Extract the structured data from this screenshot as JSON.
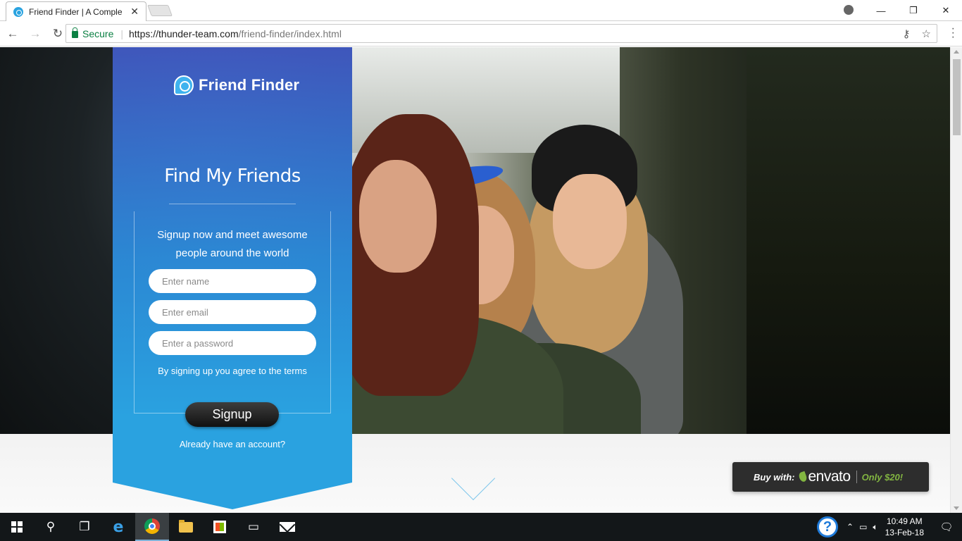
{
  "browser": {
    "tab_title": "Friend Finder | A Comple",
    "tab_close": "✕",
    "secure_label": "Secure",
    "url_host": "https://thunder-team.com",
    "url_path": "/friend-finder/index.html",
    "window_controls": {
      "minimize": "—",
      "maximize": "❐",
      "close": "✕"
    }
  },
  "page": {
    "brand_name": "Friend Finder",
    "title": "Find My Friends",
    "tagline_line1": "Signup now and meet awesome",
    "tagline_line2": "people around the world",
    "name_placeholder": "Enter name",
    "email_placeholder": "Enter email",
    "password_placeholder": "Enter a password",
    "terms_text": "By signing up you agree to the terms",
    "signup_label": "Signup",
    "login_text": "Already have an account?"
  },
  "envato": {
    "buy_with": "Buy with:",
    "brand": "envato",
    "price": "Only $20!"
  },
  "taskbar": {
    "time": "10:49 AM",
    "date": "13-Feb-18"
  },
  "colors": {
    "panel_top": "#425bc8",
    "panel_bottom": "#2aa2e0",
    "envato_green": "#82b541",
    "secure_green": "#0b8043"
  }
}
